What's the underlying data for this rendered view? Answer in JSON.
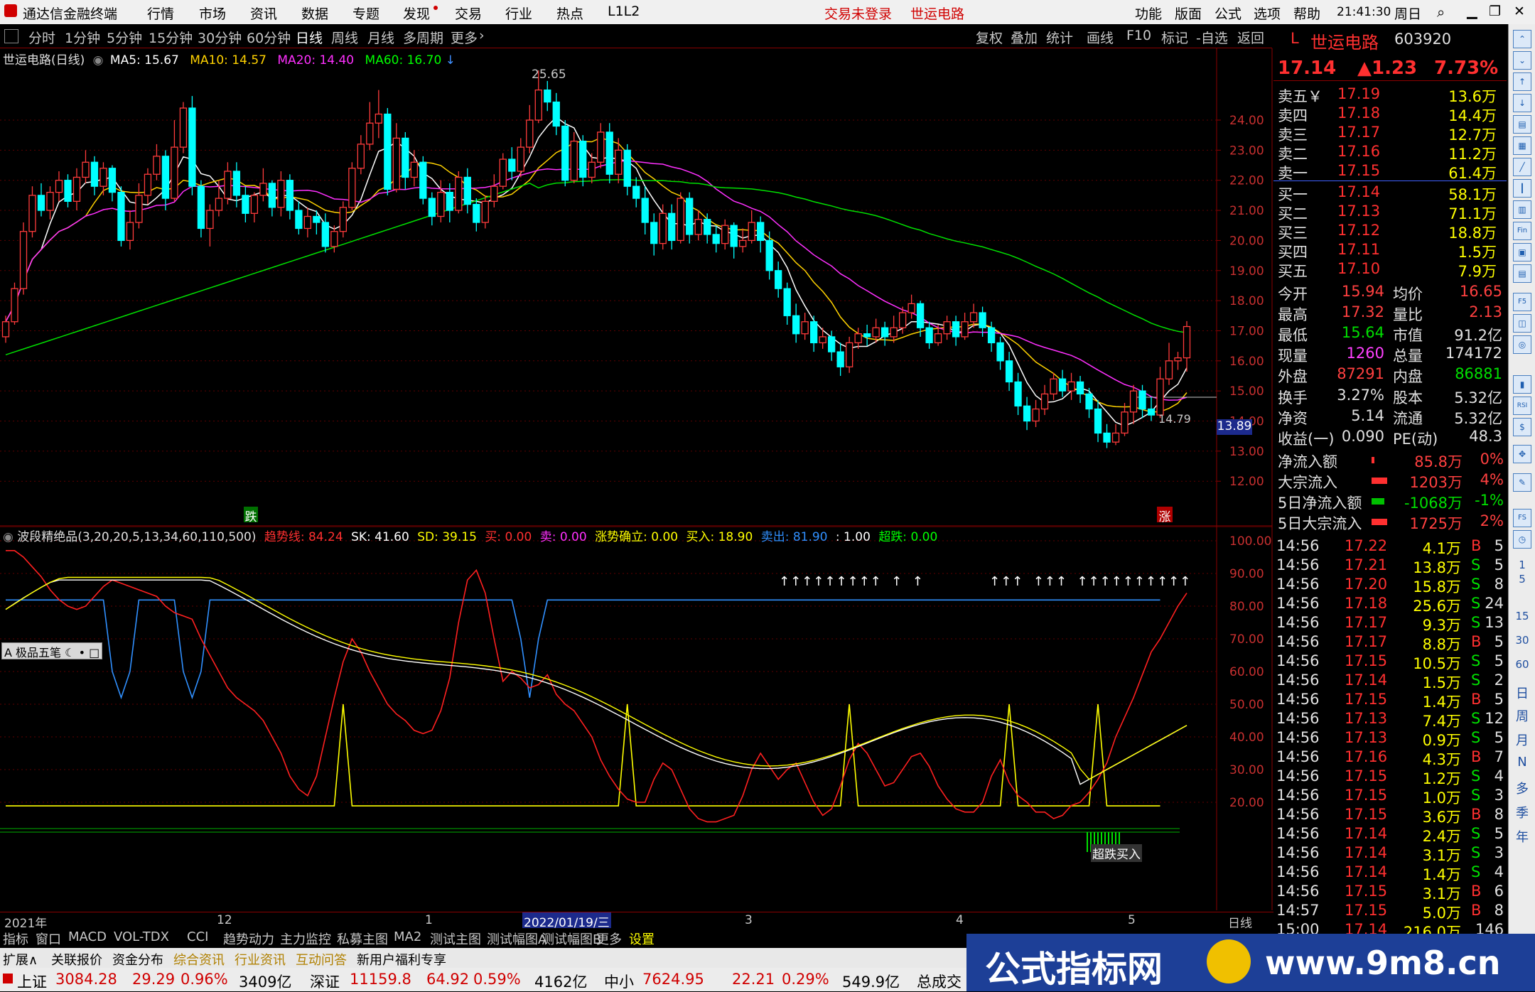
{
  "app": {
    "logo_text": "通达信金融终端",
    "menu": [
      "行情",
      "市场",
      "资讯",
      "数据",
      "专题",
      "发现",
      "交易",
      "行业",
      "热点",
      "L1L2"
    ],
    "status_trade": "交易未登录",
    "stock_title": "世运电路",
    "menu_right": [
      "功能",
      "版面",
      "公式",
      "选项",
      "帮助"
    ],
    "clock": "21:41:30",
    "weekday": "周日"
  },
  "periods": [
    "分时",
    "1分钟",
    "5分钟",
    "15分钟",
    "30分钟",
    "60分钟",
    "日线",
    "周线",
    "月线",
    "多周期",
    "更多"
  ],
  "tools": [
    "复权",
    "叠加",
    "统计",
    "画线",
    "F10",
    "标记",
    "-自选",
    "返回"
  ],
  "main_chart": {
    "legend_name": "世运电路(日线)",
    "ma_labels": [
      {
        "text": "MA5: 15.67",
        "color": "#ffffff"
      },
      {
        "text": "MA10: 14.57",
        "color": "#ffd200"
      },
      {
        "text": "MA20: 14.40",
        "color": "#ff30ff"
      },
      {
        "text": "MA60: 16.70",
        "color": "#00ff00"
      }
    ],
    "high_mark": "25.65",
    "low_mark": "14.79",
    "price_axis": [
      "24.00",
      "23.00",
      "22.00",
      "21.00",
      "20.00",
      "19.00",
      "18.00",
      "17.00",
      "16.00",
      "15.00",
      "14.00",
      "13.00",
      "12.00"
    ],
    "last_price_tag": "13.89",
    "label_down": "跌",
    "label_up": "涨"
  },
  "chart_data": {
    "type": "candlestick",
    "ylim": [
      12,
      25.7
    ],
    "candles": [
      [
        16.8,
        17.3,
        17.5,
        16.6
      ],
      [
        17.3,
        18.4,
        18.6,
        17.2
      ],
      [
        18.4,
        20.3,
        20.6,
        18.2
      ],
      [
        20.3,
        21.5,
        21.8,
        20.1
      ],
      [
        21.5,
        21.0,
        21.9,
        20.8
      ],
      [
        21.0,
        21.6,
        21.8,
        20.7
      ],
      [
        21.6,
        22.0,
        22.3,
        21.3
      ],
      [
        22.0,
        21.3,
        22.2,
        21.1
      ],
      [
        21.3,
        22.1,
        22.4,
        21.0
      ],
      [
        22.1,
        22.6,
        23.0,
        21.9
      ],
      [
        22.6,
        21.8,
        22.8,
        21.5
      ],
      [
        21.8,
        22.4,
        22.6,
        21.5
      ],
      [
        22.4,
        21.6,
        22.5,
        21.3
      ],
      [
        21.6,
        20.0,
        21.8,
        19.8
      ],
      [
        20.0,
        20.6,
        21.0,
        19.7
      ],
      [
        20.6,
        21.5,
        21.9,
        20.4
      ],
      [
        21.5,
        22.2,
        22.4,
        21.2
      ],
      [
        22.2,
        22.8,
        23.2,
        22.0
      ],
      [
        22.8,
        21.4,
        23.0,
        21.0
      ],
      [
        21.4,
        23.1,
        24.0,
        21.3
      ],
      [
        23.1,
        24.4,
        24.6,
        22.9
      ],
      [
        24.4,
        21.8,
        24.8,
        21.5
      ],
      [
        21.8,
        20.4,
        22.0,
        20.1
      ],
      [
        20.4,
        21.0,
        21.2,
        19.8
      ],
      [
        21.0,
        21.4,
        22.0,
        20.8
      ],
      [
        21.4,
        22.3,
        22.6,
        21.2
      ],
      [
        22.3,
        21.5,
        22.6,
        21.1
      ],
      [
        21.5,
        20.9,
        21.8,
        20.6
      ],
      [
        20.9,
        21.5,
        21.6,
        20.6
      ],
      [
        21.5,
        21.9,
        22.4,
        21.3
      ],
      [
        21.9,
        21.1,
        22.0,
        20.8
      ],
      [
        21.1,
        22.0,
        22.3,
        20.8
      ],
      [
        22.0,
        21.0,
        22.2,
        20.7
      ],
      [
        21.0,
        20.4,
        21.3,
        20.2
      ],
      [
        20.4,
        20.8,
        21.1,
        20.1
      ],
      [
        20.8,
        20.6,
        21.0,
        20.2
      ],
      [
        20.6,
        19.8,
        20.9,
        19.6
      ],
      [
        19.8,
        20.3,
        20.5,
        19.6
      ],
      [
        20.3,
        21.1,
        21.3,
        20.1
      ],
      [
        21.1,
        22.4,
        22.6,
        21.0
      ],
      [
        22.4,
        23.2,
        23.5,
        22.2
      ],
      [
        23.2,
        23.9,
        24.6,
        23.0
      ],
      [
        23.9,
        24.2,
        25.0,
        23.4
      ],
      [
        24.2,
        21.7,
        24.4,
        21.5
      ],
      [
        21.7,
        23.4,
        23.9,
        21.6
      ],
      [
        23.4,
        22.1,
        23.6,
        21.7
      ],
      [
        22.1,
        22.6,
        23.0,
        21.8
      ],
      [
        22.6,
        21.4,
        22.8,
        21.2
      ],
      [
        21.4,
        20.8,
        21.6,
        20.5
      ],
      [
        20.8,
        21.6,
        22.0,
        20.6
      ],
      [
        21.6,
        21.0,
        21.9,
        20.6
      ],
      [
        21.0,
        22.1,
        22.3,
        20.9
      ],
      [
        22.1,
        21.2,
        22.4,
        20.9
      ],
      [
        21.2,
        20.6,
        21.4,
        20.3
      ],
      [
        20.6,
        21.3,
        21.5,
        20.4
      ],
      [
        21.3,
        21.8,
        22.2,
        21.1
      ],
      [
        21.8,
        22.7,
        22.9,
        21.7
      ],
      [
        22.7,
        22.3,
        23.1,
        22.0
      ],
      [
        22.3,
        23.1,
        23.4,
        22.1
      ],
      [
        23.1,
        24.0,
        24.5,
        22.9
      ],
      [
        24.0,
        25.0,
        25.65,
        23.9
      ],
      [
        25.0,
        24.6,
        25.3,
        24.3
      ],
      [
        24.6,
        23.8,
        24.9,
        23.5
      ],
      [
        23.8,
        22.0,
        24.0,
        21.8
      ],
      [
        22.0,
        23.3,
        23.6,
        21.9
      ],
      [
        23.3,
        22.1,
        23.5,
        21.8
      ],
      [
        22.1,
        22.6,
        22.9,
        21.9
      ],
      [
        22.6,
        23.6,
        23.9,
        22.4
      ],
      [
        23.6,
        22.2,
        23.9,
        21.9
      ],
      [
        22.2,
        23.0,
        23.4,
        21.9
      ],
      [
        23.0,
        21.8,
        23.2,
        21.5
      ],
      [
        21.8,
        21.4,
        22.1,
        21.1
      ],
      [
        21.4,
        20.6,
        21.8,
        20.2
      ],
      [
        20.6,
        19.9,
        20.9,
        19.5
      ],
      [
        19.9,
        20.9,
        21.2,
        19.7
      ],
      [
        20.9,
        20.0,
        21.2,
        19.7
      ],
      [
        20.0,
        21.4,
        21.6,
        19.9
      ],
      [
        21.4,
        20.2,
        21.6,
        19.9
      ],
      [
        20.2,
        20.7,
        21.0,
        20.0
      ],
      [
        20.7,
        20.2,
        20.9,
        19.9
      ],
      [
        20.2,
        19.9,
        20.5,
        19.6
      ],
      [
        19.9,
        20.5,
        20.7,
        19.7
      ],
      [
        20.5,
        19.8,
        20.6,
        19.4
      ],
      [
        19.8,
        20.0,
        20.4,
        19.6
      ],
      [
        20.0,
        20.6,
        21.0,
        19.9
      ],
      [
        20.6,
        20.0,
        20.8,
        19.6
      ],
      [
        20.0,
        19.0,
        20.3,
        18.7
      ],
      [
        19.0,
        18.4,
        19.3,
        18.1
      ],
      [
        18.4,
        17.5,
        18.6,
        17.2
      ],
      [
        17.5,
        16.9,
        17.9,
        16.6
      ],
      [
        16.9,
        17.3,
        17.6,
        16.7
      ],
      [
        17.3,
        16.6,
        17.5,
        16.3
      ],
      [
        16.6,
        16.8,
        17.1,
        16.4
      ],
      [
        16.8,
        16.3,
        17.0,
        16.0
      ],
      [
        16.3,
        15.8,
        16.6,
        15.5
      ],
      [
        15.8,
        16.6,
        16.8,
        15.6
      ],
      [
        16.6,
        16.9,
        17.1,
        16.4
      ],
      [
        16.9,
        16.8,
        17.2,
        16.5
      ],
      [
        16.8,
        17.1,
        17.4,
        16.6
      ],
      [
        17.1,
        16.8,
        17.3,
        16.5
      ],
      [
        16.8,
        17.1,
        17.5,
        16.6
      ],
      [
        17.1,
        17.6,
        17.8,
        16.9
      ],
      [
        17.6,
        17.9,
        18.2,
        17.4
      ],
      [
        17.9,
        17.1,
        18.0,
        16.8
      ],
      [
        17.1,
        16.6,
        17.3,
        16.4
      ],
      [
        16.6,
        16.9,
        17.2,
        16.5
      ],
      [
        16.9,
        17.3,
        17.5,
        16.7
      ],
      [
        17.3,
        16.8,
        17.5,
        16.5
      ],
      [
        16.8,
        17.3,
        17.6,
        16.7
      ],
      [
        17.3,
        17.6,
        17.9,
        17.1
      ],
      [
        17.6,
        17.1,
        17.8,
        16.8
      ],
      [
        17.1,
        16.6,
        17.3,
        16.3
      ],
      [
        16.6,
        16.0,
        16.8,
        15.7
      ],
      [
        16.0,
        15.3,
        16.3,
        15.0
      ],
      [
        15.3,
        14.5,
        15.6,
        14.2
      ],
      [
        14.5,
        14.0,
        14.8,
        13.7
      ],
      [
        14.0,
        14.4,
        14.7,
        13.8
      ],
      [
        14.4,
        14.9,
        15.2,
        14.2
      ],
      [
        14.9,
        15.4,
        15.6,
        14.7
      ],
      [
        15.4,
        15.0,
        15.7,
        14.8
      ],
      [
        15.0,
        15.3,
        15.6,
        14.7
      ],
      [
        15.3,
        14.9,
        15.5,
        14.6
      ],
      [
        14.9,
        14.4,
        15.1,
        14.1
      ],
      [
        14.4,
        13.6,
        14.7,
        13.3
      ],
      [
        13.6,
        13.3,
        13.9,
        13.1
      ],
      [
        13.3,
        13.6,
        13.9,
        13.2
      ],
      [
        13.6,
        14.3,
        14.6,
        13.5
      ],
      [
        14.3,
        15.0,
        15.2,
        13.9
      ],
      [
        15.0,
        14.4,
        15.2,
        14.1
      ],
      [
        14.4,
        14.2,
        14.8,
        14.0
      ],
      [
        14.2,
        15.4,
        15.8,
        14.1
      ],
      [
        15.4,
        16.0,
        16.6,
        15.2
      ],
      [
        16.0,
        16.1,
        16.3,
        15.7
      ],
      [
        16.1,
        17.14,
        17.32,
        15.64
      ]
    ]
  },
  "indicator": {
    "title": "波段精绝品(3,20,20,5,13,34,60,110,500)",
    "labels": [
      {
        "text": "趋势线: 84.24",
        "color": "#ff3030"
      },
      {
        "text": "SK: 41.60",
        "color": "#ffffff"
      },
      {
        "text": "SD: 39.15",
        "color": "#ffff00"
      },
      {
        "text": "买: 0.00",
        "color": "#ff3030"
      },
      {
        "text": "卖: 0.00",
        "color": "#ff30ff"
      },
      {
        "text": "涨势确立: 0.00",
        "color": "#ffff00"
      },
      {
        "text": "买入: 18.90",
        "color": "#ffff00"
      },
      {
        "text": "卖出: 81.90",
        "color": "#3090ff"
      },
      {
        "text": ": 1.00",
        "color": "#ffffff"
      },
      {
        "text": "超跌: 0.00",
        "color": "#00ff00"
      }
    ],
    "axis": [
      "100.00",
      "90.00",
      "80.00",
      "70.00",
      "60.00",
      "50.00",
      "40.00",
      "30.00",
      "20.00"
    ],
    "overlay_btn": "极品五笔",
    "signal_text": "超跌买入",
    "arrows_1": "↑↑↑↑↑↑↑↑↑  ↑  ↑",
    "arrows_2": "↑↑↑  ↑↑↑  ↑↑↑↑↑↑↑↑↑↑"
  },
  "time_axis": {
    "labels": [
      "2021年",
      "12",
      "1",
      "2022/01/19/三",
      "3",
      "4",
      "5"
    ],
    "right_label": "日线"
  },
  "quote": {
    "badge": "L",
    "name": "世运电路",
    "code": "603920",
    "price": "17.14",
    "change": "▲1.23",
    "change_pct": "7.73%",
    "asks": [
      {
        "label": "卖五￥",
        "price": "17.19",
        "vol": "13.6万"
      },
      {
        "label": "卖四",
        "price": "17.18",
        "vol": "14.4万"
      },
      {
        "label": "卖三",
        "price": "17.17",
        "vol": "12.7万"
      },
      {
        "label": "卖二",
        "price": "17.16",
        "vol": "11.2万"
      },
      {
        "label": "卖一",
        "price": "17.15",
        "vol": "61.4万"
      }
    ],
    "bids": [
      {
        "label": "买一",
        "price": "17.14",
        "vol": "58.1万"
      },
      {
        "label": "买二",
        "price": "17.13",
        "vol": "71.1万"
      },
      {
        "label": "买三",
        "price": "17.12",
        "vol": "18.8万"
      },
      {
        "label": "买四",
        "price": "17.11",
        "vol": "1.5万"
      },
      {
        "label": "买五",
        "price": "17.10",
        "vol": "7.9万"
      }
    ],
    "stats": [
      {
        "l": "今开",
        "v": "15.94",
        "vc": "#ff4040",
        "l2": "均价",
        "v2": "16.65",
        "v2c": "#ff4040"
      },
      {
        "l": "最高",
        "v": "17.32",
        "vc": "#ff4040",
        "l2": "量比",
        "v2": "2.13",
        "v2c": "#ff4040"
      },
      {
        "l": "最低",
        "v": "15.64",
        "vc": "#00e000",
        "l2": "市值",
        "v2": "91.2亿",
        "v2c": "#e0e0e0"
      },
      {
        "l": "现量",
        "v": "1260",
        "vc": "#ff40ff",
        "l2": "总量",
        "v2": "174172",
        "v2c": "#e0e0e0"
      },
      {
        "l": "外盘",
        "v": "87291",
        "vc": "#ff4040",
        "l2": "内盘",
        "v2": "86881",
        "v2c": "#00e000"
      }
    ],
    "stats2": [
      {
        "l": "换手",
        "v": "3.27%",
        "l2": "股本",
        "v2": "5.32亿"
      },
      {
        "l": "净资",
        "v": "5.14",
        "l2": "流通",
        "v2": "5.32亿"
      },
      {
        "l": "收益(一)",
        "v": "0.090",
        "l2": "PE(动)",
        "v2": "48.3"
      }
    ],
    "flows": [
      {
        "l": "净流入额",
        "v": "85.8万",
        "vc": "#ff4040",
        "p": "0%",
        "pc": "#ff4040",
        "bar": 4
      },
      {
        "l": "大宗流入",
        "v": "1203万",
        "vc": "#ff4040",
        "p": "4%",
        "pc": "#ff4040",
        "bar": 22
      },
      {
        "l": "5日净流入额",
        "v": "-1068万",
        "vc": "#00e000",
        "p": "-1%",
        "pc": "#00e000",
        "bar": 18
      },
      {
        "l": "5日大宗流入",
        "v": "1725万",
        "vc": "#ff4040",
        "p": "2%",
        "pc": "#ff4040",
        "bar": 22
      }
    ],
    "ticks": [
      {
        "t": "14:56",
        "p": "17.22",
        "v": "4.1万",
        "bs": "B",
        "n": "5"
      },
      {
        "t": "14:56",
        "p": "17.21",
        "v": "13.8万",
        "bs": "S",
        "n": "5"
      },
      {
        "t": "14:56",
        "p": "17.20",
        "v": "15.8万",
        "bs": "S",
        "n": "8"
      },
      {
        "t": "14:56",
        "p": "17.18",
        "v": "25.6万",
        "bs": "S",
        "n": "24"
      },
      {
        "t": "14:56",
        "p": "17.17",
        "v": "9.3万",
        "bs": "S",
        "n": "13"
      },
      {
        "t": "14:56",
        "p": "17.17",
        "v": "8.8万",
        "bs": "B",
        "n": "5"
      },
      {
        "t": "14:56",
        "p": "17.15",
        "v": "10.5万",
        "bs": "S",
        "n": "5"
      },
      {
        "t": "14:56",
        "p": "17.14",
        "v": "1.5万",
        "bs": "S",
        "n": "2"
      },
      {
        "t": "14:56",
        "p": "17.15",
        "v": "1.4万",
        "bs": "B",
        "n": "5"
      },
      {
        "t": "14:56",
        "p": "17.13",
        "v": "7.4万",
        "bs": "S",
        "n": "12"
      },
      {
        "t": "14:56",
        "p": "17.13",
        "v": "0.9万",
        "bs": "S",
        "n": "5"
      },
      {
        "t": "14:56",
        "p": "17.16",
        "v": "4.3万",
        "bs": "B",
        "n": "7"
      },
      {
        "t": "14:56",
        "p": "17.15",
        "v": "1.2万",
        "bs": "S",
        "n": "4"
      },
      {
        "t": "14:56",
        "p": "17.15",
        "v": "1.0万",
        "bs": "S",
        "n": "3"
      },
      {
        "t": "14:56",
        "p": "17.15",
        "v": "3.6万",
        "bs": "B",
        "n": "8"
      },
      {
        "t": "14:56",
        "p": "17.14",
        "v": "2.4万",
        "bs": "S",
        "n": "5"
      },
      {
        "t": "14:56",
        "p": "17.14",
        "v": "3.1万",
        "bs": "S",
        "n": "3"
      },
      {
        "t": "14:56",
        "p": "17.14",
        "v": "1.4万",
        "bs": "S",
        "n": "4"
      },
      {
        "t": "14:56",
        "p": "17.15",
        "v": "3.1万",
        "bs": "B",
        "n": "6"
      },
      {
        "t": "14:57",
        "p": "17.15",
        "v": "5.0万",
        "bs": "B",
        "n": "8"
      },
      {
        "t": "15:00",
        "p": "17.14",
        "v": "216.0万",
        "bs": "",
        "n": "146"
      }
    ]
  },
  "side_icons": [
    "日",
    "周",
    "月",
    "N",
    "多",
    "季",
    "年"
  ],
  "tabs": [
    "指标",
    "窗口",
    "MACD",
    "VOL-TDX",
    "CCI",
    "趋势动力",
    "主力监控",
    "私募主图",
    "MA2",
    "测试主图",
    "测试幅图A",
    "测试幅图B",
    "更多",
    "设置"
  ],
  "ext_tabs": [
    "扩展∧",
    "关联报价",
    "资金分布",
    "综合资讯",
    "行业资讯",
    "互动问答",
    "新用户福利专享"
  ],
  "status": [
    {
      "text": "上证",
      "color": "#000000"
    },
    {
      "text": "3084.28",
      "color": "#d00000"
    },
    {
      "text": "29.29",
      "color": "#d00000"
    },
    {
      "text": "0.96%",
      "color": "#d00000"
    },
    {
      "text": "3409亿",
      "color": "#000000"
    },
    {
      "text": "深证",
      "color": "#000000"
    },
    {
      "text": "11159.8",
      "color": "#d00000"
    },
    {
      "text": "64.92",
      "color": "#d00000"
    },
    {
      "text": "0.59%",
      "color": "#d00000"
    },
    {
      "text": "4162亿",
      "color": "#000000"
    },
    {
      "text": "中小",
      "color": "#000000"
    },
    {
      "text": "7624.95",
      "color": "#d00000"
    },
    {
      "text": "22.21",
      "color": "#d00000"
    },
    {
      "text": "0.29%",
      "color": "#d00000"
    },
    {
      "text": "549.9亿",
      "color": "#000000"
    },
    {
      "text": "总成交",
      "color": "#000000"
    }
  ],
  "watermark": {
    "text": "公式指标网",
    "url": "www.9m8.cn"
  }
}
